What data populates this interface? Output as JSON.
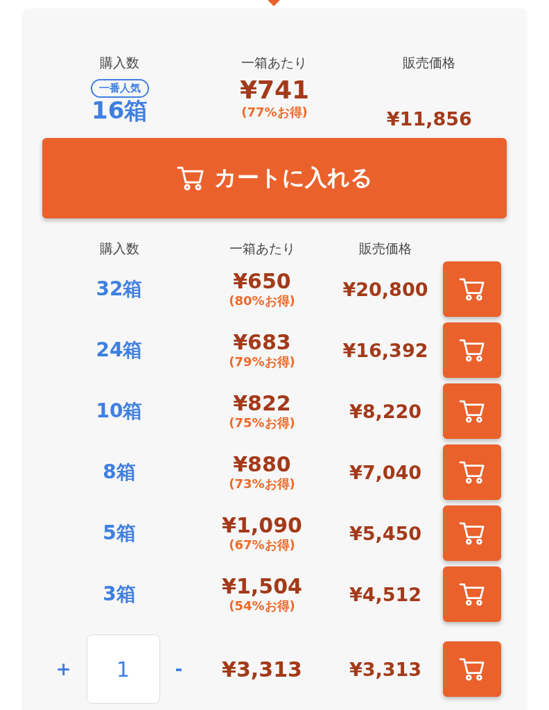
{
  "featured": {
    "headers": [
      "購入数",
      "一箱あたり",
      "販売価格"
    ],
    "badge": "一番人気",
    "quantity": "16箱",
    "unit_price": "¥741",
    "discount": "(77%お得)",
    "total": "¥11,856",
    "cart_button": "カートに入れる"
  },
  "table": {
    "headers": [
      "購入数",
      "一箱あたり",
      "販売価格"
    ],
    "rows": [
      {
        "quantity": "32箱",
        "unit_price": "¥650",
        "discount": "(80%お得)",
        "total": "¥20,800"
      },
      {
        "quantity": "24箱",
        "unit_price": "¥683",
        "discount": "(79%お得)",
        "total": "¥16,392"
      },
      {
        "quantity": "10箱",
        "unit_price": "¥822",
        "discount": "(75%お得)",
        "total": "¥8,220"
      },
      {
        "quantity": "8箱",
        "unit_price": "¥880",
        "discount": "(73%お得)",
        "total": "¥7,040"
      },
      {
        "quantity": "5箱",
        "unit_price": "¥1,090",
        "discount": "(67%お得)",
        "total": "¥5,450"
      },
      {
        "quantity": "3箱",
        "unit_price": "¥1,504",
        "discount": "(54%お得)",
        "total": "¥4,512"
      }
    ]
  },
  "custom": {
    "plus": "+",
    "value": "1",
    "minus": "-",
    "unit_price": "¥3,313",
    "total": "¥3,313"
  }
}
